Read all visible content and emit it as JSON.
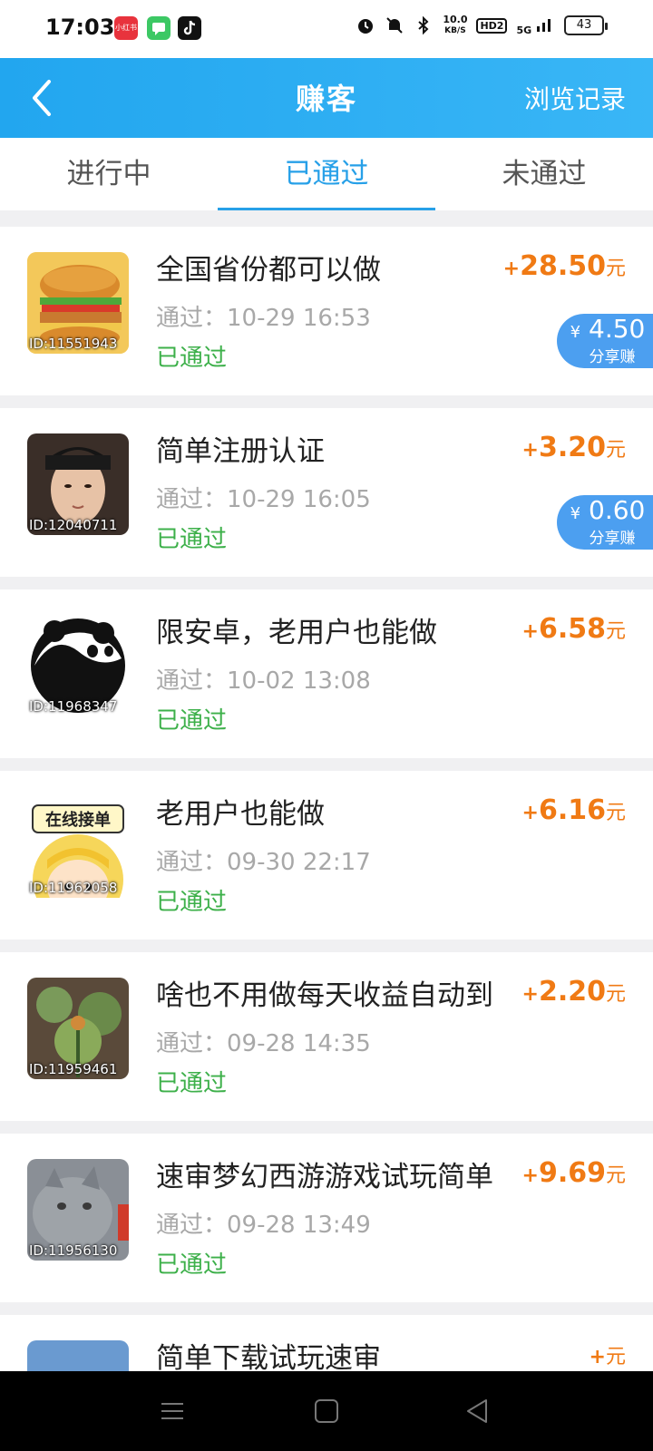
{
  "status_bar": {
    "time": "17:03",
    "apps": [
      "小红书",
      "",
      ""
    ],
    "net_speed_value": "10.0",
    "net_speed_unit": "KB/S",
    "hd_label": "HD2",
    "signal_label": "5G",
    "battery": "43"
  },
  "header": {
    "title": "赚客",
    "right_action": "浏览记录"
  },
  "tabs": [
    {
      "label": "进行中",
      "active": false
    },
    {
      "label": "已通过",
      "active": true
    },
    {
      "label": "未通过",
      "active": false
    }
  ],
  "items": [
    {
      "title": "全国省份都可以做",
      "time": "通过：10-29 16:53",
      "status": "已通过",
      "reward_sign": "+",
      "reward": "28.50",
      "unit": "元",
      "id_label": "ID:11551943",
      "share_amount": "4.50",
      "share_label": "分享赚",
      "yen": "¥"
    },
    {
      "title": "简单注册认证",
      "time": "通过：10-29 16:05",
      "status": "已通过",
      "reward_sign": "+",
      "reward": "3.20",
      "unit": "元",
      "id_label": "ID:12040711",
      "share_amount": "0.60",
      "share_label": "分享赚",
      "yen": "¥"
    },
    {
      "title": "限安卓，老用户也能做",
      "time": "通过：10-02 13:08",
      "status": "已通过",
      "reward_sign": "+",
      "reward": "6.58",
      "unit": "元",
      "id_label": "ID:11968347"
    },
    {
      "title": "老用户也能做",
      "time": "通过：09-30 22:17",
      "status": "已通过",
      "reward_sign": "+",
      "reward": "6.16",
      "unit": "元",
      "id_label": "ID:11962058",
      "thumb_text": "在线接单"
    },
    {
      "title": "啥也不用做每天收益自动到",
      "time": "通过：09-28 14:35",
      "status": "已通过",
      "reward_sign": "+",
      "reward": "2.20",
      "unit": "元",
      "id_label": "ID:11959461"
    },
    {
      "title": "速审梦幻西游游戏试玩简单",
      "time": "通过：09-28 13:49",
      "status": "已通过",
      "reward_sign": "+",
      "reward": "9.69",
      "unit": "元",
      "id_label": "ID:11956130"
    },
    {
      "title": "简单下载试玩速审",
      "time": "",
      "status": "",
      "reward_sign": "+",
      "reward": "",
      "unit": "元",
      "id_label": ""
    }
  ],
  "colors": {
    "header_blue": "#22a6ef",
    "active_tab": "#27a0e8",
    "reward_orange": "#f07a14",
    "passed_green": "#3db04a",
    "share_blue": "#4c9ff0"
  }
}
